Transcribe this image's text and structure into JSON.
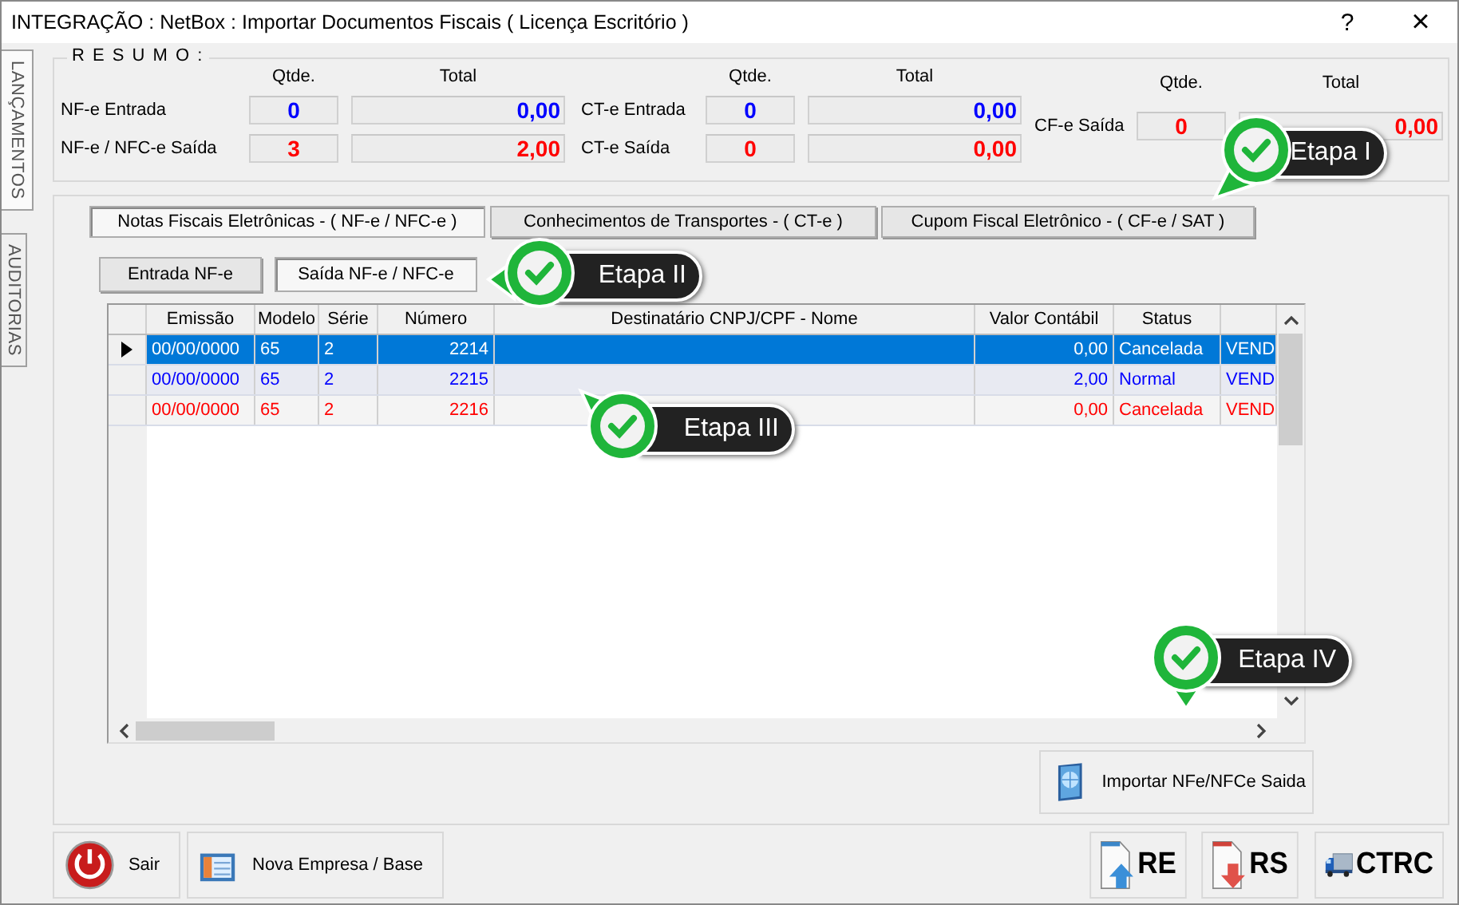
{
  "window": {
    "title": "INTEGRAÇÃO : NetBox :  Importar Documentos Fiscais ( Licença Escritório )",
    "help": "?",
    "close": "×"
  },
  "side_tabs": [
    {
      "label": "LANÇAMENTOS",
      "selected": true
    },
    {
      "label": "AUDITORIAS",
      "selected": false
    }
  ],
  "summary": {
    "title": "R E S U M O :",
    "groups": [
      {
        "qty_header": "Qtde.",
        "total_header": "Total",
        "rows": [
          {
            "label": "NF-e Entrada",
            "qty": "0",
            "total": "0,00",
            "color": "#0000ff"
          },
          {
            "label": "NF-e / NFC-e Saída",
            "qty": "3",
            "total": "2,00",
            "color": "#ff0000"
          }
        ]
      },
      {
        "qty_header": "Qtde.",
        "total_header": "Total",
        "rows": [
          {
            "label": "CT-e Entrada",
            "qty": "0",
            "total": "0,00",
            "color": "#0000ff"
          },
          {
            "label": "CT-e Saída",
            "qty": "0",
            "total": "0,00",
            "color": "#ff0000"
          }
        ]
      },
      {
        "qty_header": "Qtde.",
        "total_header": "Total",
        "rows": [
          {
            "label": "CF-e Saída",
            "qty": "0",
            "total": "0,00",
            "color": "#ff0000"
          }
        ]
      }
    ]
  },
  "tabs": [
    {
      "label": "Notas Fiscais Eletrônicas - ( NF-e / NFC-e )",
      "selected": true
    },
    {
      "label": "Conhecimentos de Transportes - ( CT-e )",
      "selected": false
    },
    {
      "label": "Cupom Fiscal Eletrônico - ( CF-e / SAT )",
      "selected": false
    }
  ],
  "sub_tabs": [
    {
      "label": "Entrada NF-e",
      "selected": false
    },
    {
      "label": "Saída NF-e / NFC-e",
      "selected": true
    }
  ],
  "table": {
    "columns": [
      "Emissão",
      "Modelo",
      "Série",
      "Número",
      "Destinatário CNPJ/CPF - Nome",
      "Valor Contábil",
      "Status"
    ],
    "rows": [
      {
        "cells": [
          "00/00/0000",
          "65",
          "2",
          "2214",
          "",
          "0,00",
          "Cancelada",
          "VEND"
        ],
        "selected": true
      },
      {
        "cells": [
          "00/00/0000",
          "65",
          "2",
          "2215",
          "",
          "2,00",
          "Normal",
          "VEND"
        ],
        "selected": false,
        "color": "#0000ff"
      },
      {
        "cells": [
          "00/00/0000",
          "65",
          "2",
          "2216",
          "",
          "0,00",
          "Cancelada",
          "VEND"
        ],
        "selected": false,
        "color": "#ff0000"
      }
    ]
  },
  "import_button": "Importar NFe/NFCe Saida",
  "bottom_left": [
    {
      "kind": "power",
      "label": "Sair"
    },
    {
      "kind": "calendar",
      "label": "Nova Empresa / Base"
    }
  ],
  "bottom_right": [
    {
      "kind": "up",
      "label": "RE"
    },
    {
      "kind": "down",
      "label": "RS"
    },
    {
      "kind": "truck",
      "label": "CTRC"
    }
  ],
  "callouts": [
    {
      "label": "Etapa I"
    },
    {
      "label": "Etapa II"
    },
    {
      "label": "Etapa III"
    },
    {
      "label": "Etapa IV"
    }
  ]
}
